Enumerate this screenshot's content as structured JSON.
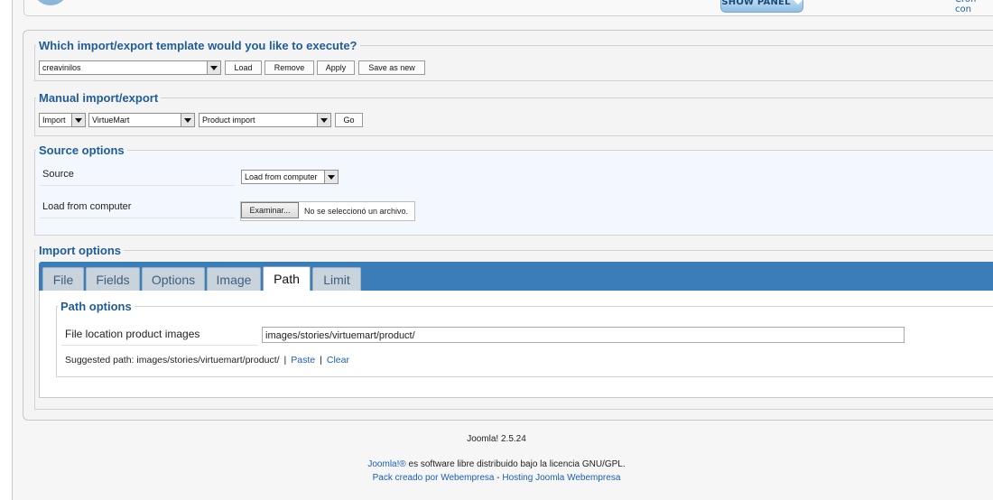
{
  "header": {
    "show_panel_label": "SHOW PANEL",
    "corner_link": "Cron con"
  },
  "template_section": {
    "legend": "Which import/export template would you like to execute?",
    "template_select_value": "creavinilos",
    "buttons": {
      "load": "Load",
      "remove": "Remove",
      "apply": "Apply",
      "save_as_new": "Save as new"
    }
  },
  "manual_section": {
    "legend": "Manual import/export",
    "action_value": "Import",
    "component_value": "VirtueMart",
    "operation_value": "Product import",
    "go_label": "Go"
  },
  "source_section": {
    "legend": "Source options",
    "source_label": "Source",
    "source_value": "Load from computer",
    "load_label": "Load from computer",
    "browse_label": "Examinar...",
    "no_file_text": "No se seleccionó un archivo."
  },
  "import_options": {
    "legend": "Import options",
    "tabs": [
      {
        "label": "File"
      },
      {
        "label": "Fields"
      },
      {
        "label": "Options"
      },
      {
        "label": "Image"
      },
      {
        "label": "Path"
      },
      {
        "label": "Limit"
      }
    ],
    "active_tab": "Path",
    "path_options": {
      "legend": "Path options",
      "file_location_label": "File location product images",
      "file_location_value": "images/stories/virtuemart/product/",
      "suggested_prefix": "Suggested path: images/stories/virtuemart/product/",
      "paste_label": "Paste",
      "clear_label": "Clear",
      "separator": "|"
    }
  },
  "footer": {
    "version": "Joomla! 2.5.24",
    "joomla_link": "Joomla!®",
    "license_text": " es software libre distribuido bajo la licencia GNU/GPL.",
    "pack_link": "Pack creado por Webempresa",
    "dash": " - ",
    "hosting_link": "Hosting Joomla Webempresa"
  },
  "colors": {
    "accent": "#1f5c99",
    "tab_strip": "#3a7db8",
    "link": "#1a5fb4"
  }
}
